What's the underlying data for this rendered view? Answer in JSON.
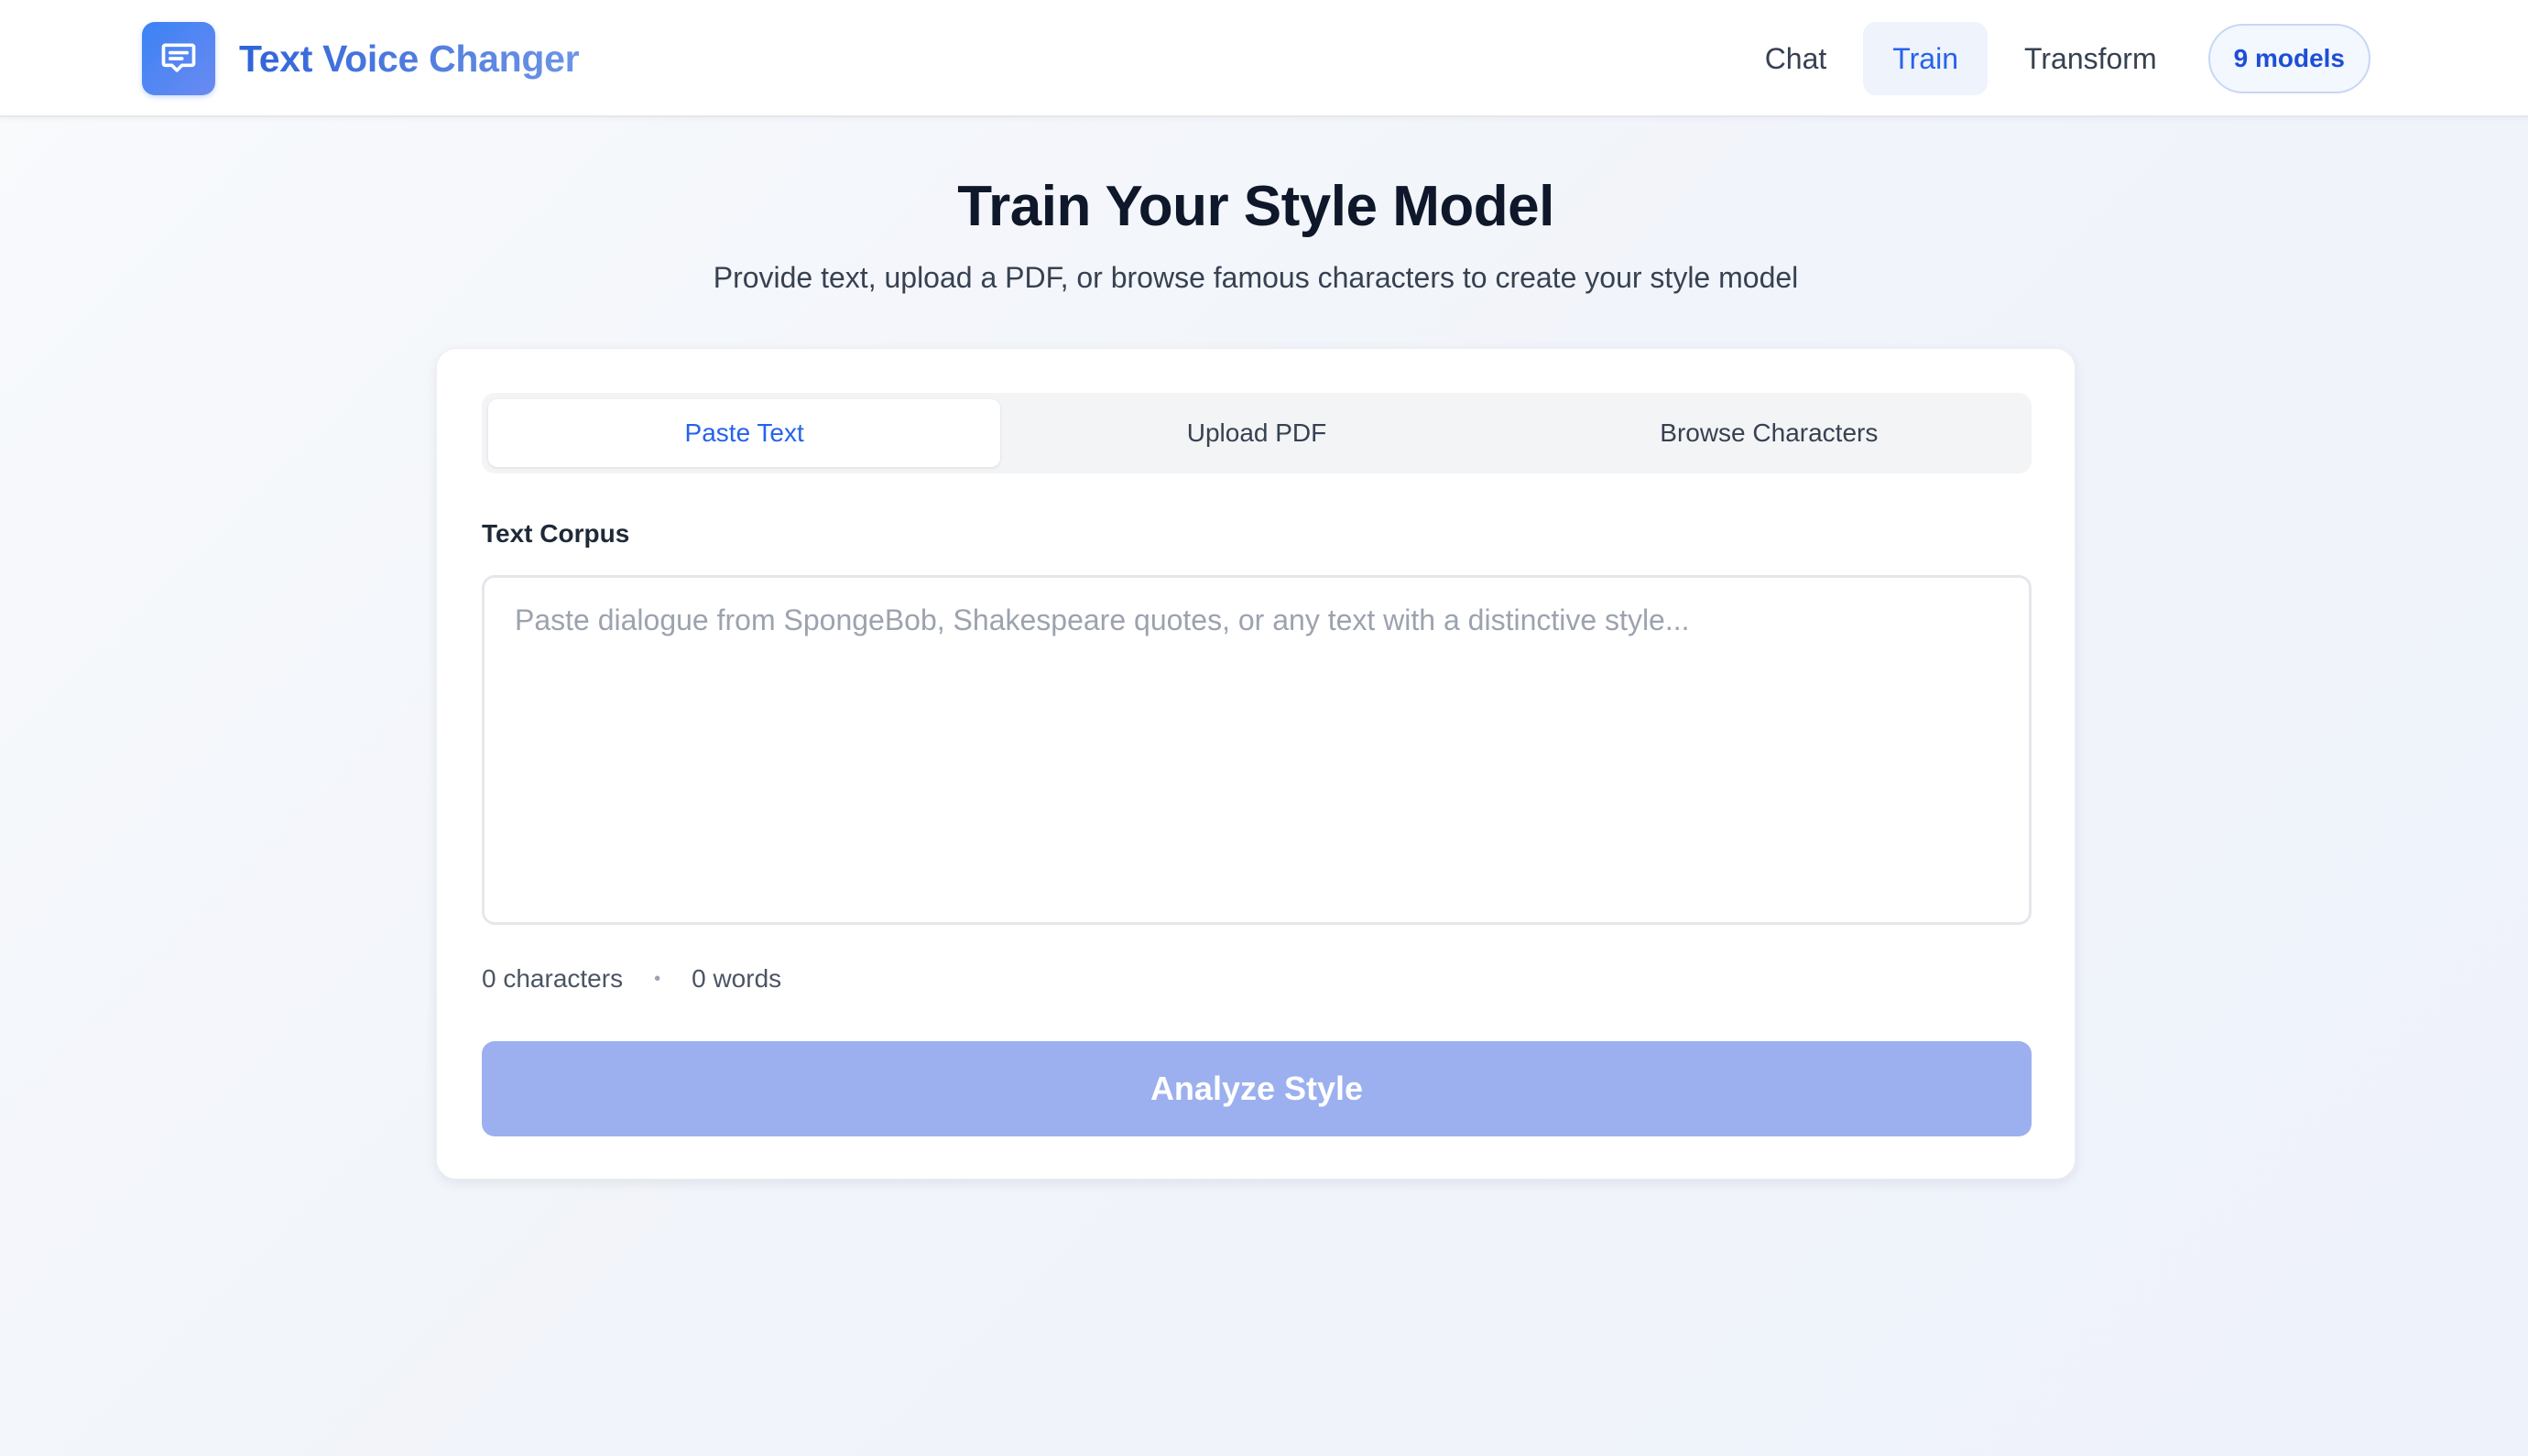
{
  "app": {
    "name": "Text Voice Changer",
    "logo_icon": "chat-bubble-icon"
  },
  "nav": {
    "items": [
      {
        "label": "Chat",
        "active": false
      },
      {
        "label": "Train",
        "active": true
      },
      {
        "label": "Transform",
        "active": false
      }
    ],
    "models_badge": "9 models"
  },
  "page": {
    "title": "Train Your Style Model",
    "subtitle": "Provide text, upload a PDF, or browse famous characters to create your style model"
  },
  "tabs": [
    {
      "label": "Paste Text",
      "active": true
    },
    {
      "label": "Upload PDF",
      "active": false
    },
    {
      "label": "Browse Characters",
      "active": false
    }
  ],
  "corpus": {
    "label": "Text Corpus",
    "value": "",
    "placeholder": "Paste dialogue from SpongeBob, Shakespeare quotes, or any text with a distinctive style..."
  },
  "stats": {
    "characters": "0 characters",
    "separator": "•",
    "words": "0 words"
  },
  "actions": {
    "analyze_label": "Analyze Style",
    "analyze_enabled": false
  },
  "colors": {
    "accent": "#2563eb",
    "button_disabled": "#9cb0ef",
    "background": "#f1f4fa"
  }
}
